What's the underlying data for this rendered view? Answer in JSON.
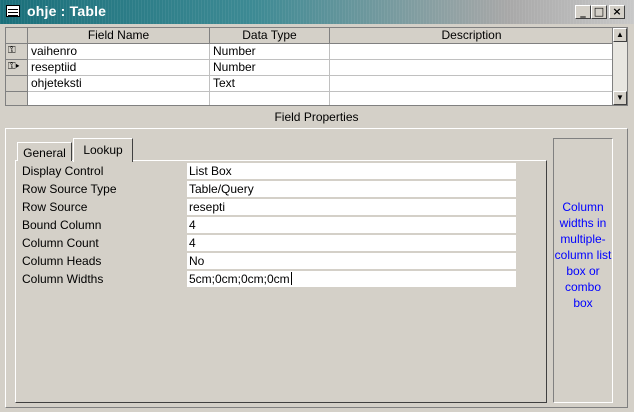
{
  "window": {
    "title": "ohje : Table",
    "buttons": {
      "minimize": "_",
      "restore": "□",
      "close": "×"
    }
  },
  "grid": {
    "headers": [
      "Field Name",
      "Data Type",
      "Description"
    ],
    "rows": [
      {
        "name": "vaihenro",
        "type": "Number",
        "description": "",
        "key": true,
        "current": false
      },
      {
        "name": "reseptiid",
        "type": "Number",
        "description": "",
        "key": true,
        "current": true
      },
      {
        "name": "ohjeteksti",
        "type": "Text",
        "description": "",
        "key": false,
        "current": false
      },
      {
        "name": "",
        "type": "",
        "description": "",
        "key": false,
        "current": false
      }
    ]
  },
  "field_properties": {
    "title": "Field Properties",
    "tabs": [
      "General",
      "Lookup"
    ],
    "active_tab": "Lookup",
    "properties": [
      {
        "label": "Display Control",
        "value": "List Box"
      },
      {
        "label": "Row Source Type",
        "value": "Table/Query"
      },
      {
        "label": "Row Source",
        "value": "resepti"
      },
      {
        "label": "Bound Column",
        "value": "4"
      },
      {
        "label": "Column Count",
        "value": "4"
      },
      {
        "label": "Column Heads",
        "value": "No"
      },
      {
        "label": "Column Widths",
        "value": "5cm;0cm;0cm;0cm"
      }
    ],
    "help_text": "Column widths in multiple-column list box or combo box"
  },
  "colors": {
    "title_start": "#1a6f7a",
    "help_text": "#0000ff",
    "face": "#d4d0c8"
  }
}
